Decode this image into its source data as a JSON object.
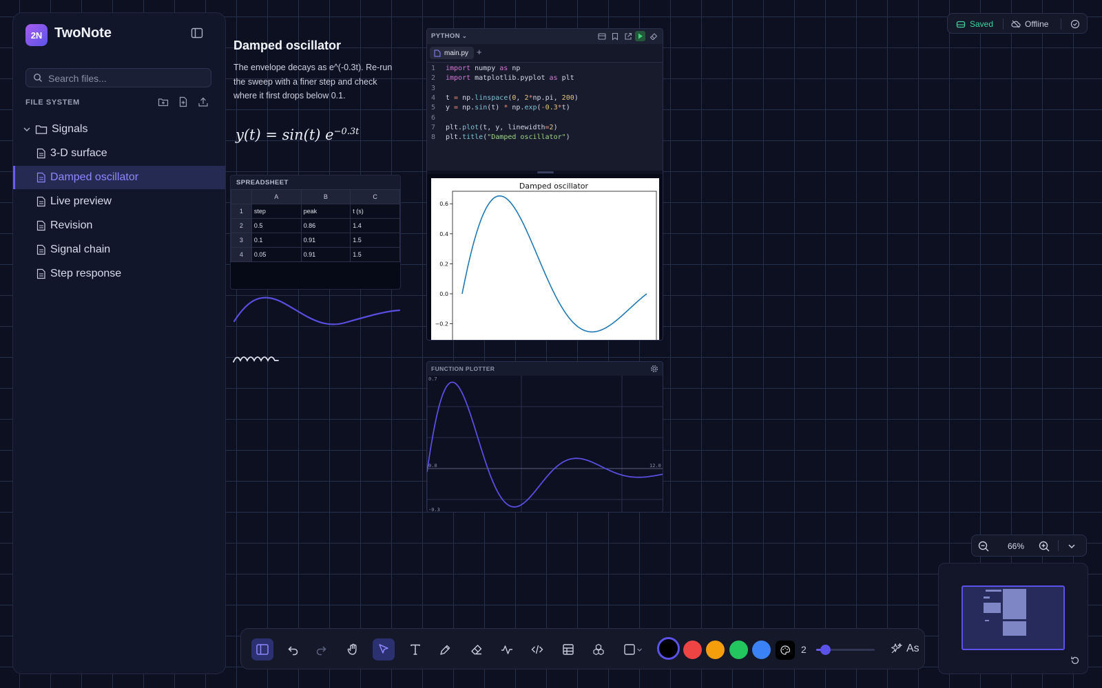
{
  "app": {
    "title": "TwoNote",
    "logo_text": "2N"
  },
  "sidebar": {
    "search_placeholder": "Search files...",
    "section_label": "FILE SYSTEM",
    "folder": "Signals",
    "items": [
      {
        "label": "3-D surface"
      },
      {
        "label": "Damped oscillator",
        "active": true
      },
      {
        "label": "Live preview"
      },
      {
        "label": "Revision"
      },
      {
        "label": "Signal chain"
      },
      {
        "label": "Step response"
      }
    ]
  },
  "note": {
    "title": "Damped oscillator",
    "body": "The envelope decays as e^(-0.3t). Re-run the sweep with a finer step and check where it first drops below 0.1.",
    "formula_lhs": "y(t) = sin(t) e",
    "formula_exp": "−0.3t"
  },
  "spreadsheet": {
    "title": "SPREADSHEET",
    "columns": [
      "A",
      "B",
      "C"
    ],
    "rows": [
      {
        "n": "1",
        "cells": [
          "step",
          "peak",
          "t (s)"
        ]
      },
      {
        "n": "2",
        "cells": [
          "0.5",
          "0.86",
          "1.4"
        ]
      },
      {
        "n": "3",
        "cells": [
          "0.1",
          "0.91",
          "1.5"
        ]
      },
      {
        "n": "4",
        "cells": [
          "0.05",
          "0.91",
          "1.5"
        ]
      }
    ]
  },
  "python": {
    "language": "PYTHON",
    "tab": "main.py",
    "line_numbers": [
      "1",
      "2",
      "3",
      "4",
      "5",
      "6",
      "7",
      "8"
    ],
    "plot_title": "Damped oscillator",
    "y_ticks": [
      "0.6",
      "0.4",
      "0.2",
      "0.0",
      "−0.2"
    ]
  },
  "plotter": {
    "title": "FUNCTION PLOTTER",
    "y_max_label": "0.7",
    "y_min_label": "-0.3",
    "x_min_label": "0.0",
    "x_max_label": "12.0"
  },
  "status": {
    "saved": "Saved",
    "offline": "Offline"
  },
  "zoom": {
    "value": "66%"
  },
  "toolbar": {
    "stroke_width": "2",
    "ai_label": "As",
    "slider_fraction": 0.15
  },
  "colors": {
    "accent": "#6a5cf2",
    "saved": "#3fd5a0",
    "swatches": [
      "#000000",
      "#ef4444",
      "#f59e0b",
      "#22c55e",
      "#3b82f6"
    ]
  }
}
